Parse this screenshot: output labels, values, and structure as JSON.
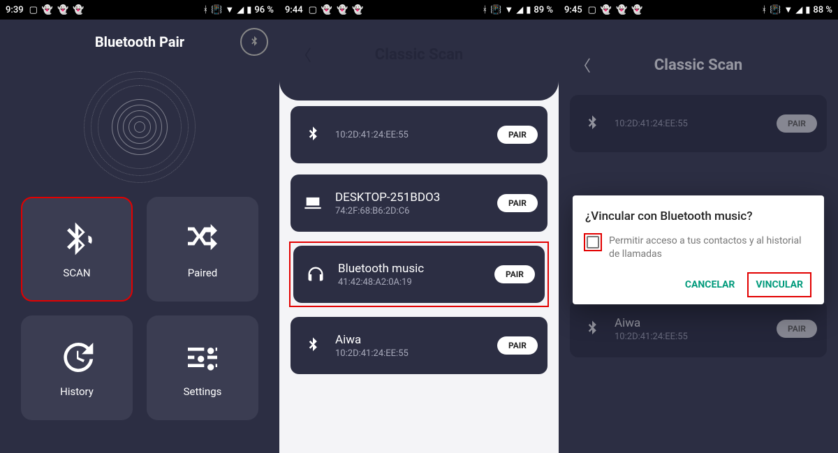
{
  "screen1": {
    "status": {
      "time": "9:39",
      "battery": "96 %"
    },
    "title": "Bluetooth Pair",
    "tiles": {
      "scan": "SCAN",
      "paired": "Paired",
      "history": "History",
      "settings": "Settings"
    }
  },
  "screen2": {
    "status": {
      "time": "9:44",
      "battery": "89 %"
    },
    "title": "Classic Scan",
    "pair_label": "PAIR",
    "devices": [
      {
        "name": "10:2D:41:24:EE:55",
        "mac": ""
      },
      {
        "name": "DESKTOP-251BDO3",
        "mac": "74:2F:68:B6:2D:C6"
      },
      {
        "name": "Bluetooth music",
        "mac": "41:42:48:A2:0A:19"
      },
      {
        "name": "Aiwa",
        "mac": "10:2D:41:24:EE:55"
      }
    ]
  },
  "screen3": {
    "status": {
      "time": "9:45",
      "battery": "88 %"
    },
    "title": "Classic Scan",
    "pair_label": "PAIR",
    "devices": [
      {
        "name": "10:2D:41:24:EE:55",
        "mac": ""
      },
      {
        "name": "Aiwa",
        "mac": "10:2D:41:24:EE:55"
      }
    ],
    "dialog": {
      "title": "¿Vincular con Bluetooth music?",
      "message": "Permitir acceso a tus contactos y al historial de llamadas",
      "cancel": "CANCELAR",
      "confirm": "VINCULAR"
    }
  }
}
